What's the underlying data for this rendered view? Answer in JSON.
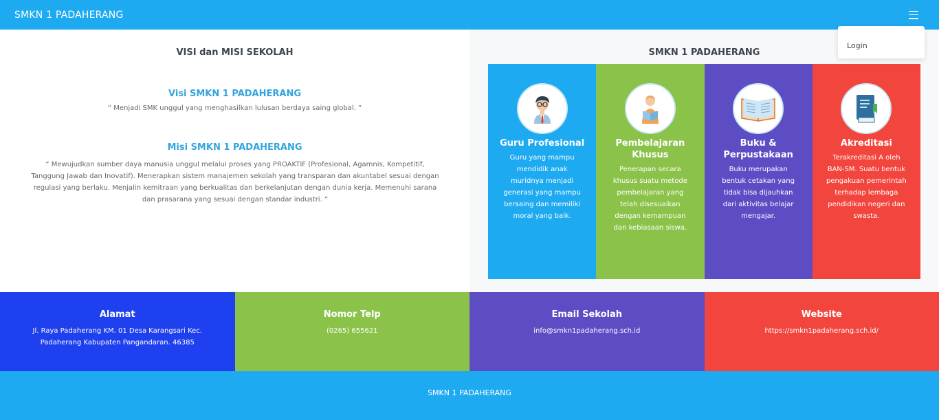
{
  "navbar": {
    "brand": "SMKN 1 PADAHERANG",
    "menu_icon": "hamburger-icon"
  },
  "dropdown": {
    "login": "Login"
  },
  "visi_misi": {
    "heading": "VISI dan MISI SEKOLAH",
    "visi_title": "Visi SMKN 1 PADAHERANG",
    "visi_text": "“ Menjadi SMK unggul yang menghasilkan lulusan berdaya saing global. ”",
    "misi_title": "Misi SMKN 1 PADAHERANG",
    "misi_text": "“ Mewujudkan sumber daya manusia unggul melalui proses yang PROAKTIF (Profesional, Agamnis, Kompetitif, Tanggung Jawab dan Inovatif). Menerapkan sistem manajemen sekolah yang transparan dan akuntabel sesuai dengan regulasi yang berlaku. Menjalin kemitraan yang berkualitas dan berkelanjutan dengan dunia kerja. Memenuhi sarana dan prasarana yang sesuai dengan standar industri. ”"
  },
  "features": {
    "heading": "SMKN 1 PADAHERANG",
    "cards": [
      {
        "title": "Guru Profesional",
        "text": "Guru yang mampu mendidik anak muridnya menjadi generasi yang mampu bersaing dan memiliki moral yang baik.",
        "color": "#1eaaf1",
        "icon": "teacher-icon"
      },
      {
        "title": "Pembelajaran Khusus",
        "text": "Penerapan secara khusus suatu metode pembelajaran yang telah disesuaikan dengan kemampuan dan kebiasaan siswa.",
        "color": "#8bc34a",
        "icon": "student-reading-icon"
      },
      {
        "title": "Buku & Perpustakaan",
        "text": "Buku merupakan bentuk cetakan yang tidak bisa dijauhkan dari aktivitas belajar mengajar.",
        "color": "#5c4dc5",
        "icon": "open-book-icon"
      },
      {
        "title": "Akreditasi",
        "text": "Terakreditasi A oleh BAN-SM. Suatu bentuk pengakuan pemerintah terhadap lembaga pendidikan negeri dan swasta.",
        "color": "#f2453d",
        "icon": "certificate-book-icon"
      }
    ]
  },
  "info": [
    {
      "title": "Alamat",
      "text": "Jl. Raya Padaherang KM. 01 Desa Karangsari Kec. Padaherang Kabupaten Pangandaran. 46385",
      "color": "#1f40ee"
    },
    {
      "title": "Nomor Telp",
      "text": "(0265) 655621",
      "color": "#8bc34a"
    },
    {
      "title": "Email Sekolah",
      "text": "info@smkn1padaherang.sch.id",
      "color": "#5c4dc5"
    },
    {
      "title": "Website",
      "text": "https://smkn1padaherang.sch.id/",
      "color": "#f2453d"
    }
  ],
  "footer": {
    "text": "SMKN 1 PADAHERANG"
  }
}
